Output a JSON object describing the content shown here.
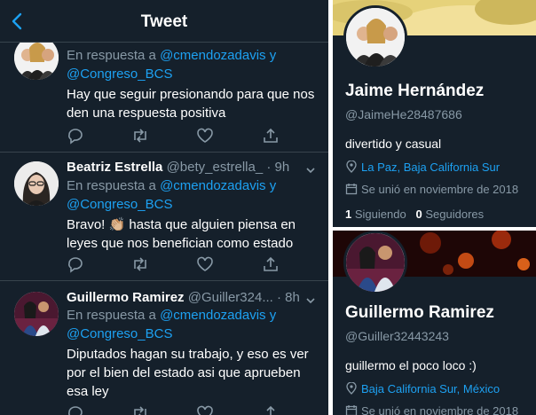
{
  "header": {
    "title": "Tweet"
  },
  "tweets": [
    {
      "reply_prefix": "En respuesta a",
      "reply_to_1": "@cmendozadavis y",
      "reply_to_2": "@Congreso_BCS",
      "text": "Hay que seguir presionando para que nos den una respuesta positiva"
    },
    {
      "name": "Beatriz Estrella",
      "handle": "@bety_estrella_ · 9h",
      "reply_prefix": "En respuesta a",
      "reply_to_1": "@cmendozadavis y",
      "reply_to_2": "@Congreso_BCS",
      "text": "Bravo! 👏🏼 hasta que alguien piensa en leyes que nos benefician como estado"
    },
    {
      "name": "Guillermo Ramirez",
      "handle": "@Guiller324... · 8h",
      "reply_prefix": "En respuesta a",
      "reply_to_1": "@cmendozadavis y",
      "reply_to_2": "@Congreso_BCS",
      "text": "Diputados hagan su trabajo, y eso es ver por el bien del estado asi que aprueben esa ley"
    }
  ],
  "profile_1": {
    "name": "Jaime Hernández",
    "handle": "@JaimeHe28487686",
    "bio": "divertido y casual",
    "location": "La Paz, Baja California Sur",
    "joined": "Se unió en noviembre de 2018",
    "following_count": "1",
    "following_label": "Siguiendo",
    "followers_count": "0",
    "followers_label": "Seguidores"
  },
  "profile_2": {
    "name": "Guillermo Ramirez",
    "handle": "@Guiller32443243",
    "bio": "guillermo el poco loco :)",
    "location": "Baja California Sur, México",
    "joined": "Se unió en noviembre de 2018"
  },
  "colors": {
    "background": "#15202b",
    "accent": "#1da1f2",
    "secondary_text": "#8899a6",
    "divider": "#38444d"
  }
}
